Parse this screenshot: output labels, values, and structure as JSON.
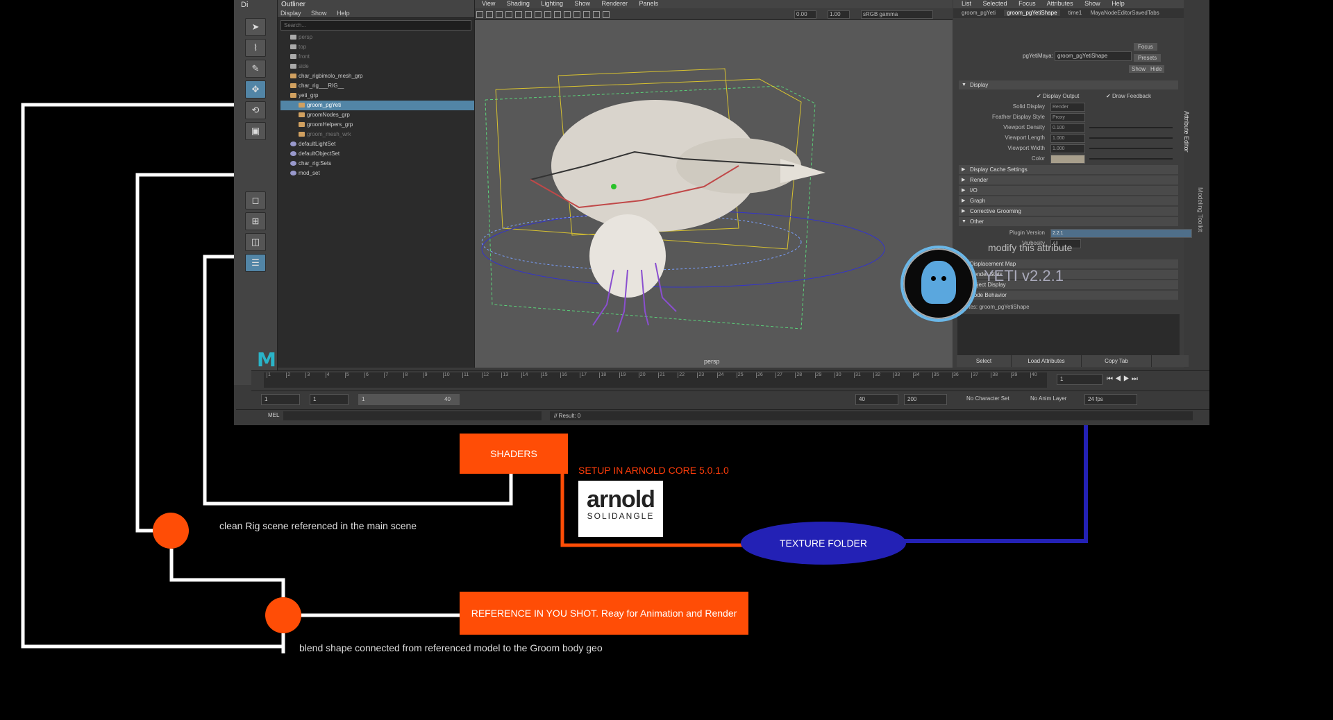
{
  "maya": {
    "toolbox_tab": "Di",
    "logo": "M",
    "outliner": {
      "title": "Outliner",
      "menu": [
        "Display",
        "Show",
        "Help"
      ],
      "search_placeholder": "Search...",
      "items": [
        {
          "label": "persp",
          "dim": true
        },
        {
          "label": "top",
          "dim": true
        },
        {
          "label": "front",
          "dim": true
        },
        {
          "label": "side",
          "dim": true
        },
        {
          "label": "char_rigbimolo_mesh_grp",
          "dim": false
        },
        {
          "label": "char_rig___RIG__",
          "dim": false
        },
        {
          "label": "yeti_grp",
          "dim": false
        },
        {
          "label": "groom_pgYeti",
          "dim": false,
          "selected": true
        },
        {
          "label": "groomNodes_grp",
          "dim": false
        },
        {
          "label": "groomHelpers_grp",
          "dim": false
        },
        {
          "label": "groom_mesh_wrk",
          "dim": true
        },
        {
          "label": "defaultLightSet",
          "dim": false
        },
        {
          "label": "defaultObjectSet",
          "dim": false
        },
        {
          "label": "char_rig:Sets",
          "dim": false
        },
        {
          "label": "mod_set",
          "dim": false
        }
      ]
    },
    "viewport": {
      "menu": [
        "View",
        "Shading",
        "Lighting",
        "Show",
        "Renderer",
        "Panels"
      ],
      "field_a": "0.00",
      "field_b": "1.00",
      "colorspace": "sRGB gamma",
      "camera_label": "persp"
    },
    "attribute_editor": {
      "menu": [
        "List",
        "Selected",
        "Focus",
        "Attributes",
        "Show",
        "Help"
      ],
      "tabs": [
        "groom_pgYeti",
        "groom_pgYetiShape",
        "time1",
        "MayaNodeEditorSavedTabs"
      ],
      "node_label": "pgYetiMaya:",
      "node_value": "groom_pgYetiShape",
      "buttons": [
        "Focus",
        "Presets",
        "Show",
        "Hide"
      ],
      "sections": [
        {
          "label": "Display",
          "open": true
        },
        {
          "label": "Display Cache Settings",
          "open": false
        },
        {
          "label": "Render",
          "open": false
        },
        {
          "label": "I/O",
          "open": false
        },
        {
          "label": "Graph",
          "open": false
        },
        {
          "label": "Corrective Grooming",
          "open": false
        },
        {
          "label": "Other",
          "open": true
        }
      ],
      "display_rows": [
        {
          "label": "Solid Display",
          "value": "Render"
        },
        {
          "label": "Feather Display Style",
          "value": "Proxy"
        },
        {
          "label": "Viewport Density",
          "value": "0.100"
        },
        {
          "label": "Viewport Length",
          "value": "1.000"
        },
        {
          "label": "Viewport Width",
          "value": "1.000"
        },
        {
          "label": "Color",
          "value": ""
        }
      ],
      "checks": [
        "Display Output",
        "Draw Feedback"
      ],
      "other_rows": [
        {
          "label": "Plugin Version",
          "value": "2.2.1"
        },
        {
          "label": "Verbosity",
          "value": "All"
        }
      ],
      "lower_sections": [
        "Displacement Map",
        "Render Stats",
        "Object Display",
        "Node Behavior"
      ],
      "notes_label": "Notes: groom_pgYetiShape",
      "bottom_buttons": [
        "Select",
        "Load Attributes",
        "Copy Tab"
      ],
      "side_tab": "Attribute Editor",
      "side_tab2": "Modeling Toolkit"
    },
    "timeline": {
      "ticks": [
        "1",
        "2",
        "3",
        "4",
        "5",
        "6",
        "7",
        "8",
        "9",
        "10",
        "11",
        "12",
        "13",
        "14",
        "15",
        "16",
        "17",
        "18",
        "19",
        "20",
        "21",
        "22",
        "23",
        "24",
        "25",
        "26",
        "27",
        "28",
        "29",
        "30",
        "31",
        "32",
        "33",
        "34",
        "35",
        "36",
        "37",
        "38",
        "39",
        "40"
      ],
      "current_frame": "1"
    },
    "range": {
      "start": "1",
      "start2": "1",
      "slider_start": "1",
      "slider_end": "40",
      "end": "40",
      "end2": "200",
      "character_set": "No Character Set",
      "anim_layer": "No Anim Layer",
      "fps": "24 fps"
    },
    "cmd": {
      "lang": "MEL",
      "result": "// Result: 0"
    }
  },
  "overlay": {
    "modify_note": "modify this attribute",
    "yeti_version": "YETI v2.2.1"
  },
  "diagram": {
    "shaders": "SHADERS",
    "setup": "SETUP IN ARNOLD CORE 5.0.1.0",
    "arnold_word": "arnold",
    "arnold_sub": "SOLIDANGLE",
    "texture_folder": "TEXTURE FOLDER",
    "reference": "REFERENCE IN YOU SHOT. Reay for Animation and Render",
    "note_clean_rig": "clean Rig scene referenced in the main scene",
    "note_blend": "blend shape connected from referenced model to the Groom body geo"
  },
  "colors": {
    "orange": "#ff4d06",
    "blue_wire": "#2321b5",
    "maya_select": "#5285a6"
  }
}
